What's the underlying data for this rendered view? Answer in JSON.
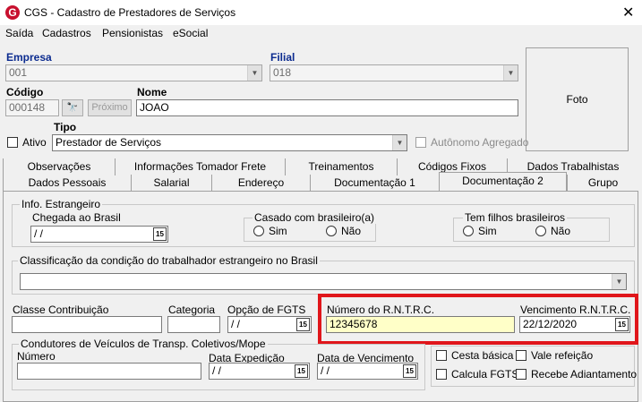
{
  "window": {
    "title": "CGS - Cadastro de Prestadores de Serviços",
    "icon_letter": "G",
    "close_glyph": "✕"
  },
  "menu": [
    "Saída",
    "Cadastros",
    "Pensionistas",
    "eSocial"
  ],
  "header": {
    "empresa_label": "Empresa",
    "empresa_value": "001",
    "filial_label": "Filial",
    "filial_value": "018",
    "codigo_label": "Código",
    "codigo_value": "000148",
    "search_glyph": "🔭",
    "proximo_label": "Próximo",
    "nome_label": "Nome",
    "nome_value": "JOAO",
    "ativo_label": "Ativo",
    "tipo_label": "Tipo",
    "tipo_value": "Prestador de Serviços",
    "autonomo_label": "Autônomo Agregado",
    "foto_label": "Foto"
  },
  "tabs_row1": [
    "Observações",
    "Informações Tomador Frete",
    "Treinamentos",
    "Códigos Fixos",
    "Dados Trabalhistas"
  ],
  "tabs_row2": [
    "Dados Pessoais",
    "Salarial",
    "Endereço",
    "Documentação 1",
    "Documentação 2",
    "Grupo"
  ],
  "active_tab": "Documentação 2",
  "estrangeiro": {
    "group_title": "Info. Estrangeiro",
    "chegada_label": "Chegada ao Brasil",
    "chegada_value": " / /",
    "casado_title": "Casado com brasileiro(a)",
    "filhos_title": "Tem filhos brasileiros",
    "sim": "Sim",
    "nao": "Não"
  },
  "classificacao": {
    "group_title": "Classificação da condição do trabalhador estrangeiro no Brasil",
    "value": ""
  },
  "fields": {
    "classe_label": "Classe Contribuição",
    "classe_value": "",
    "categoria_label": "Categoria",
    "categoria_value": "",
    "opcao_fgts_label": "Opção de FGTS",
    "opcao_fgts_value": " / /",
    "rntrc_label": "Número do R.N.T.R.C.",
    "rntrc_value": "12345678",
    "venc_rntrc_label": "Vencimento R.N.T.R.C.",
    "venc_rntrc_value": "22/12/2020"
  },
  "condutores": {
    "group_title": "Condutores de Veículos de Transp. Coletivos/Mope",
    "numero_label": "Número",
    "numero_value": "",
    "data_exp_label": "Data Expedição",
    "data_exp_value": " / /",
    "data_venc_label": "Data de Vencimento",
    "data_venc_value": " / /"
  },
  "beneficios": {
    "cesta_label": "Cesta básica",
    "vale_label": "Vale refeição",
    "calcula_fgts_label": "Calcula FGTS",
    "adiantamento_label": "Recebe Adiantamento"
  },
  "date_glyph": "15",
  "combo_glyph": "▼"
}
